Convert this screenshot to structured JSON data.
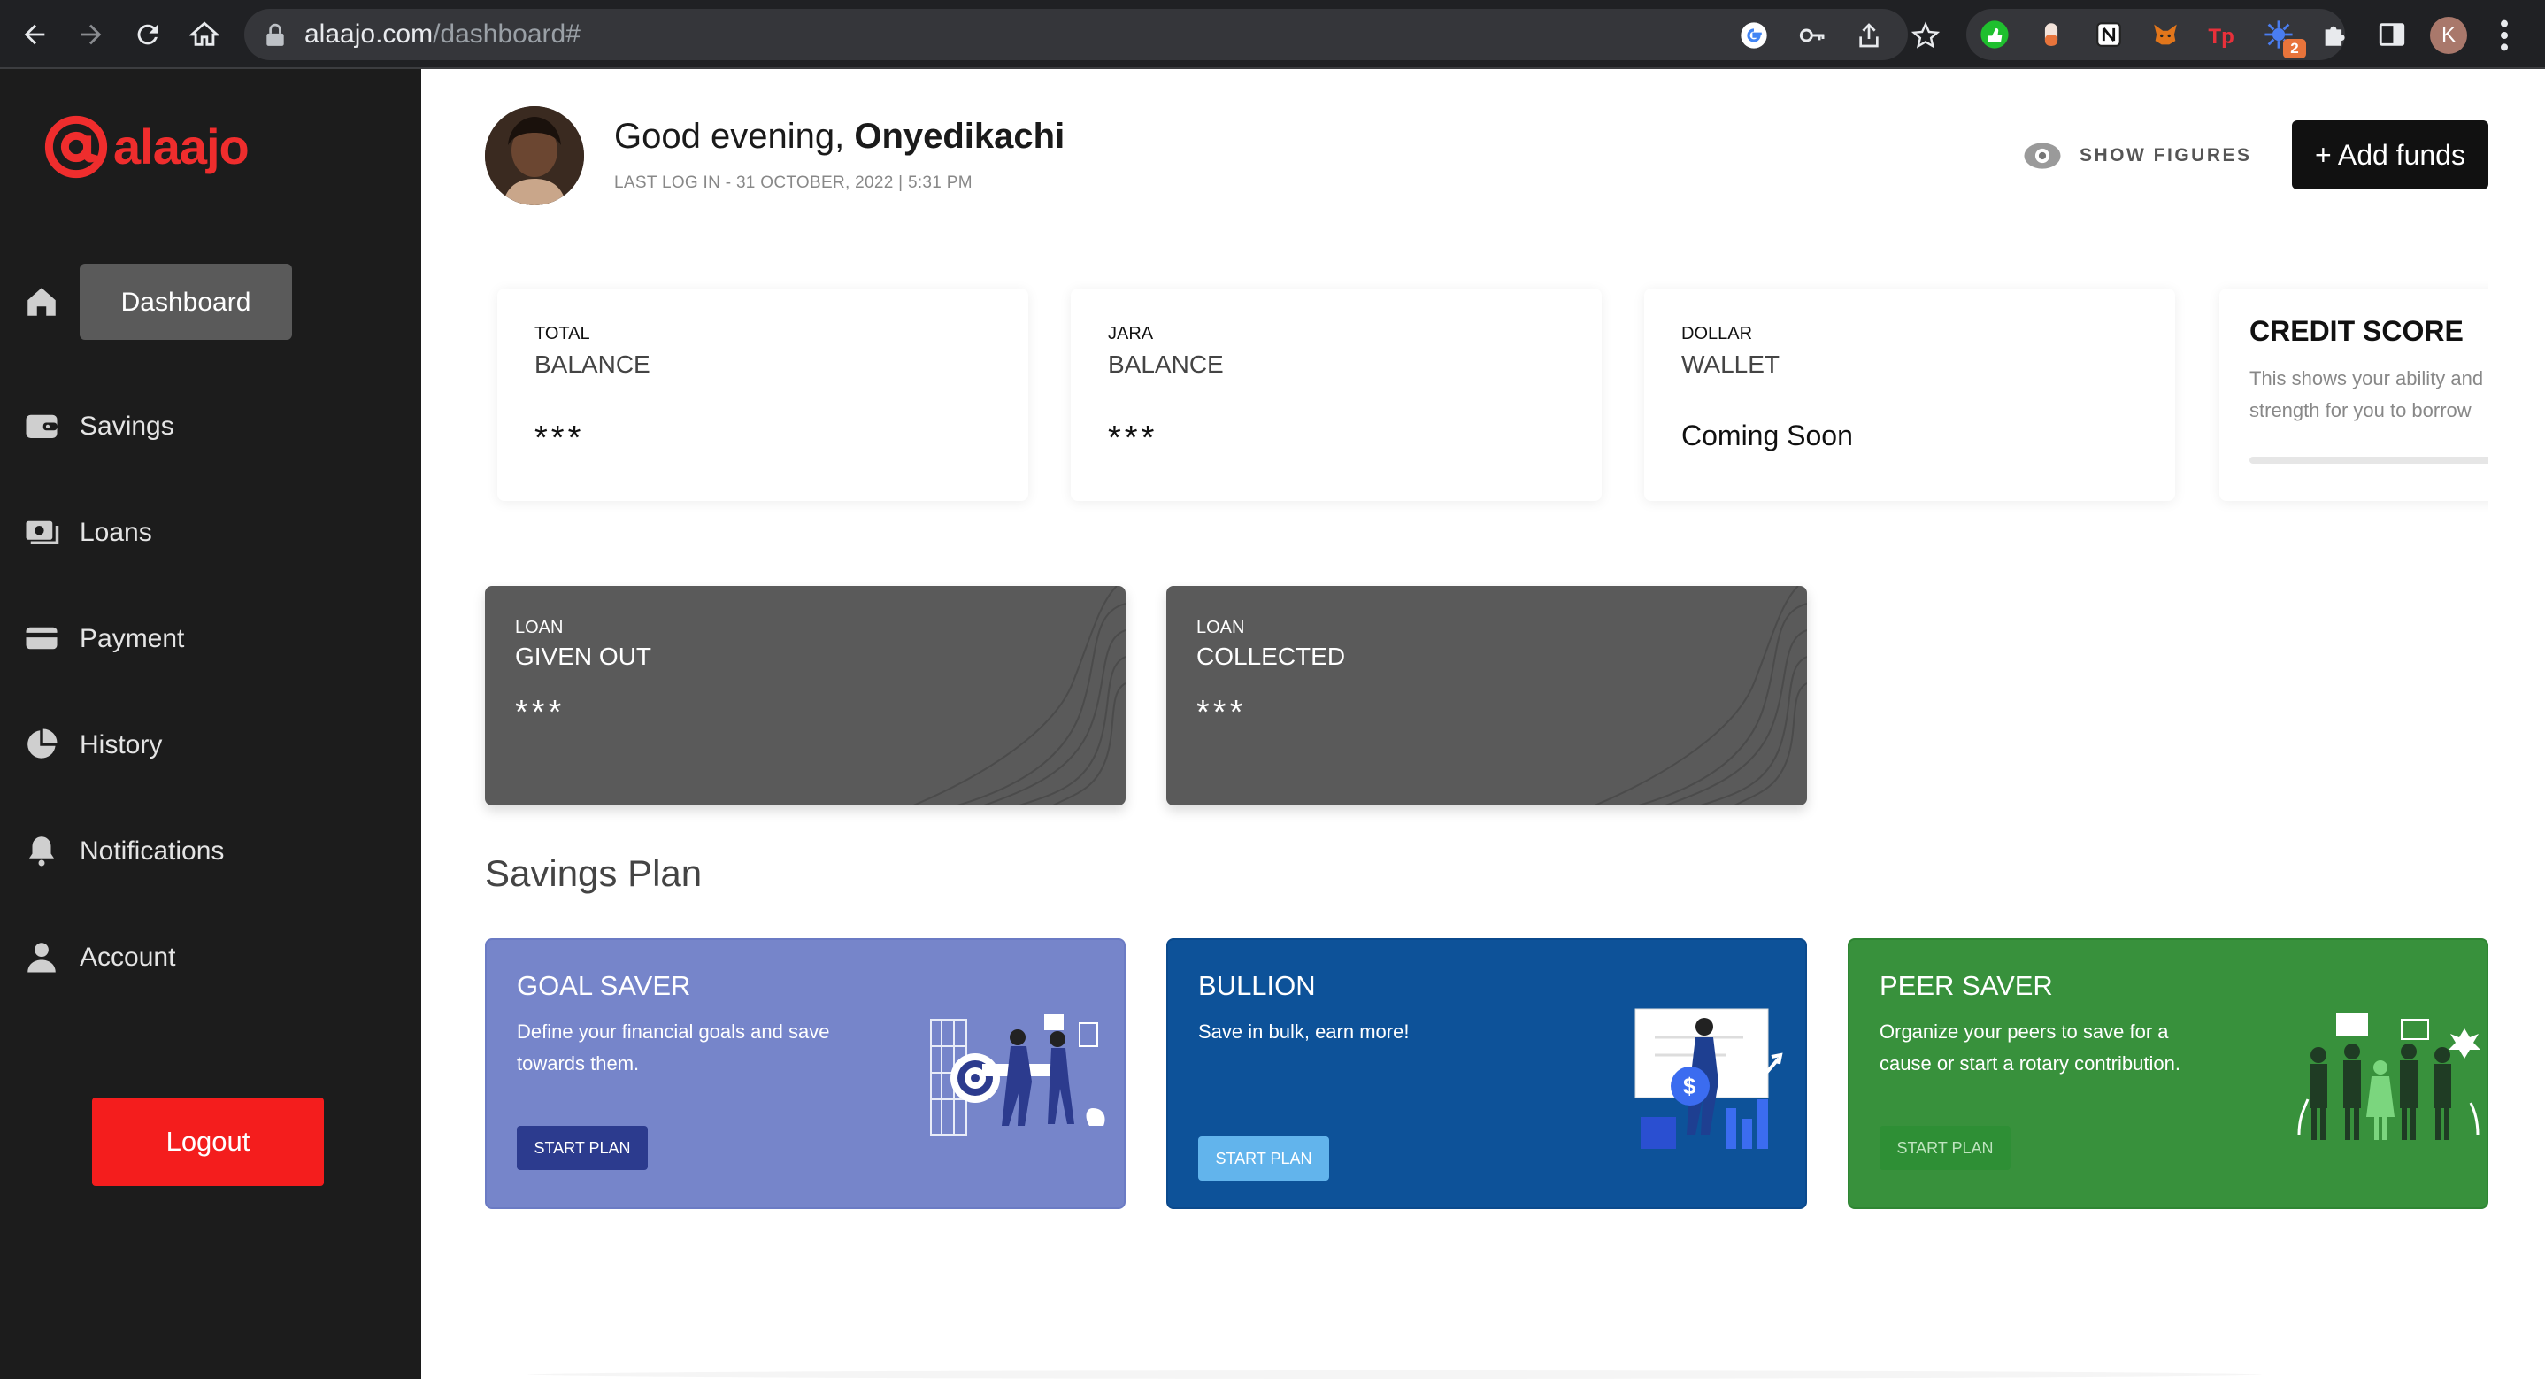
{
  "browser": {
    "url_host": "alaajo.com",
    "url_path": "/dashboard#",
    "extension_badge": "2",
    "profile_initial": "K"
  },
  "sidebar": {
    "logo_text": "alaajo",
    "items": [
      {
        "label": "Dashboard",
        "icon": "home-icon"
      },
      {
        "label": "Savings",
        "icon": "wallet-icon"
      },
      {
        "label": "Loans",
        "icon": "money-icon"
      },
      {
        "label": "Payment",
        "icon": "card-icon"
      },
      {
        "label": "History",
        "icon": "pie-chart-icon"
      },
      {
        "label": "Notifications",
        "icon": "bell-icon"
      },
      {
        "label": "Account",
        "icon": "user-icon"
      }
    ],
    "logout_label": "Logout"
  },
  "header": {
    "greeting": "Good evening,",
    "name": "Onyedikachi",
    "last_login": "LAST LOG IN - 31 OCTOBER, 2022 | 5:31 PM",
    "show_figures": "SHOW FIGURES",
    "add_funds": "+ Add funds"
  },
  "stats": [
    {
      "small": "TOTAL",
      "big": "BALANCE",
      "value": "***"
    },
    {
      "small": "JARA",
      "big": "BALANCE",
      "value": "***"
    },
    {
      "small": "DOLLAR",
      "big": "WALLET",
      "value": "Coming Soon"
    }
  ],
  "credit": {
    "title": "CREDIT SCORE",
    "desc": "This shows your ability and strength for you to borrow"
  },
  "loans": [
    {
      "small": "LOAN",
      "big": "GIVEN OUT",
      "value": "***"
    },
    {
      "small": "LOAN",
      "big": "COLLECTED",
      "value": "***"
    }
  ],
  "savings_plan": {
    "title": "Savings Plan",
    "plans": [
      {
        "title": "GOAL SAVER",
        "desc": "Define your financial goals and save towards them.",
        "button": "START PLAN",
        "color": "#7685ca"
      },
      {
        "title": "BULLION",
        "desc": "Save in bulk, earn more!",
        "button": "START PLAN",
        "color": "#0d5299"
      },
      {
        "title": "PEER SAVER",
        "desc": "Organize your peers to save for a cause or start a rotary contribution.",
        "button": "START PLAN",
        "color": "#38913c"
      }
    ]
  },
  "colors": {
    "brand_red": "#ef2d2d",
    "sidebar_bg": "#1c1c1c",
    "loan_card": "#5a5a5a"
  }
}
